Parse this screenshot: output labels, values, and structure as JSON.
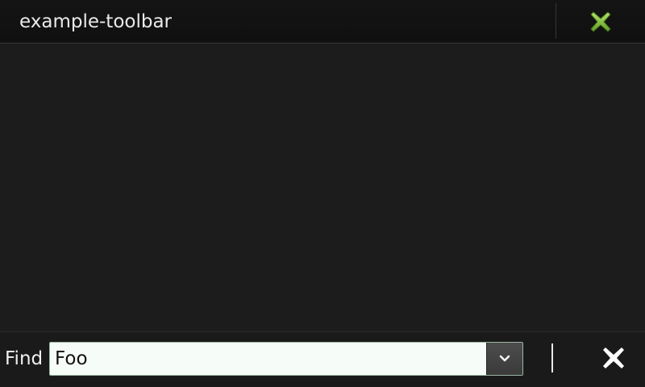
{
  "titlebar": {
    "title": "example-toolbar",
    "close_icon": "close-x-icon",
    "close_icon_color": "#8fcf4a"
  },
  "findbar": {
    "label": "Find",
    "input_value": "Foo",
    "dropdown_icon": "chevron-down-icon",
    "close_icon": "close-x-icon",
    "accent_color": "#9ab7a4"
  }
}
